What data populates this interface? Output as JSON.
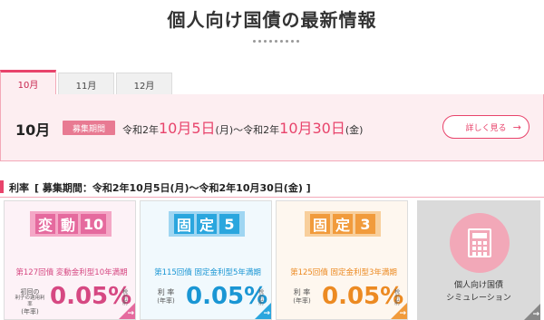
{
  "page_title": "個人向け国債の最新情報",
  "tabs": [
    {
      "label": "10月"
    },
    {
      "label": "11月"
    },
    {
      "label": "12月"
    }
  ],
  "panel": {
    "month": "10月",
    "badge": "募集期間",
    "era1": "令和2年",
    "start_date": "10月5日",
    "start_dow": "(月)",
    "tilde": "〜",
    "era2": "令和2年",
    "end_date": "10月30日",
    "end_dow": "(金)",
    "detail_button": "詳しく見る",
    "detail_arrow": "→"
  },
  "rate_section": {
    "heading": "利率",
    "period": "[ 募集期間：令和2年10月5日(月)〜令和2年10月30日(金) ]"
  },
  "cards": [
    {
      "logo_chars": [
        "変",
        "動",
        "10"
      ],
      "subtitle": "第127回債 変動金利型10年満期",
      "rate_label_line1": "初回の",
      "rate_label_line2": "利子の適用利率",
      "rate_label_line3": "(年率)",
      "rate": "0.05%",
      "annotation": "税引前",
      "arrow": "→"
    },
    {
      "logo_chars": [
        "固",
        "定",
        "5"
      ],
      "subtitle": "第115回債 固定金利型5年満期",
      "rate_label_line1": "利 率",
      "rate_label_line2": "(年率)",
      "rate": "0.05%",
      "annotation": "税引前",
      "arrow": "→"
    },
    {
      "logo_chars": [
        "固",
        "定",
        "3"
      ],
      "subtitle": "第125回債 固定金利型3年満期",
      "rate_label_line1": "利 率",
      "rate_label_line2": "(年率)",
      "rate": "0.05%",
      "annotation": "税引前",
      "arrow": "→"
    }
  ],
  "simulation": {
    "label_line1": "個人向け国債",
    "label_line2": "シミュレーション",
    "icon": "calculator-icon",
    "arrow": "→"
  },
  "colors": {
    "accent": "#e8436b",
    "variable10": "#e56a9e",
    "fixed5": "#2aa6de",
    "fixed3": "#f19b3c"
  }
}
